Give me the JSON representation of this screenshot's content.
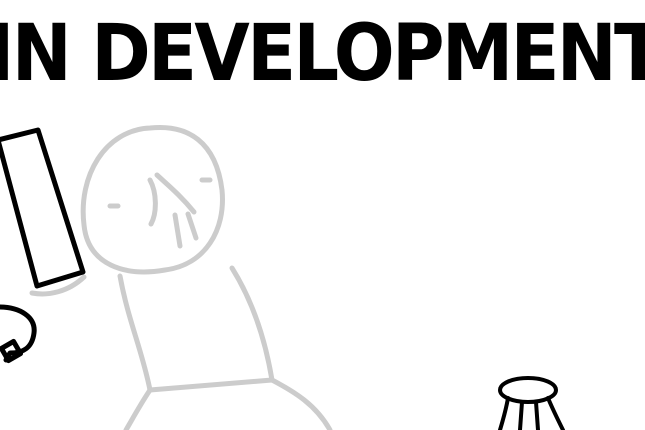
{
  "title": {
    "text": "IN DEVELOPMENT"
  },
  "colors": {
    "background": "#ffffff",
    "ink": "#000000",
    "sketch_gray": "#cccccc"
  },
  "icons": {
    "phone": "phone-icon",
    "cable": "cable-icon",
    "stool": "stool-icon"
  }
}
